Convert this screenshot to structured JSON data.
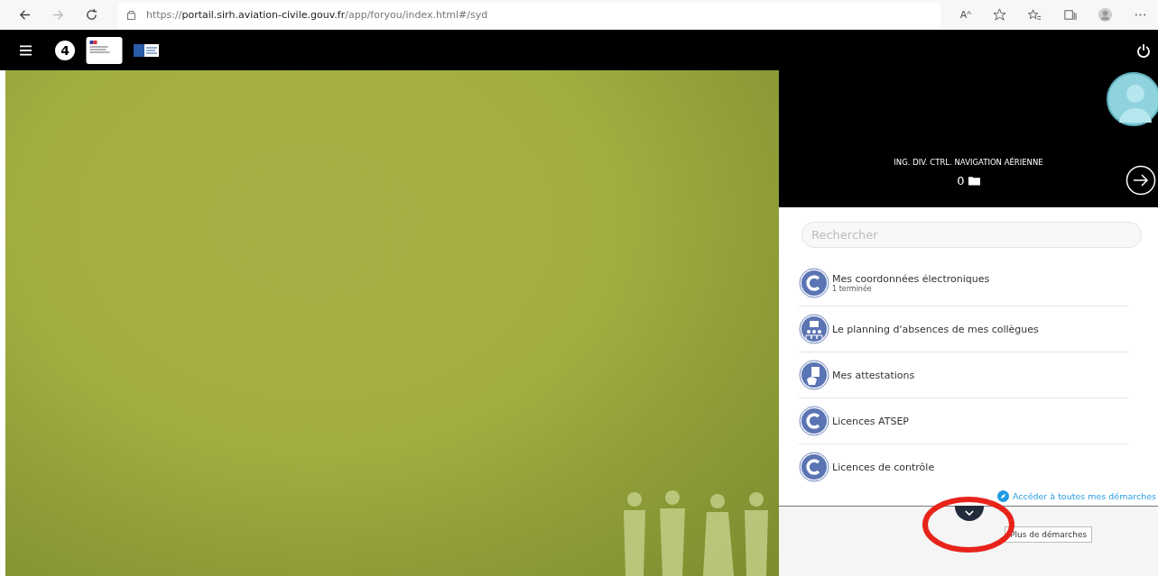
{
  "browser": {
    "url_scheme": "https://",
    "url_host": "portail.sirh.aviation-civile.gouv.fr",
    "url_path": "/app/foryou/index.html#/syd",
    "read_aloud": "Aᴬ"
  },
  "header": {
    "logo_text": "4"
  },
  "profile": {
    "title": "ING. DIV. CTRL. NAVIGATION AÉRIENNE",
    "count": "0"
  },
  "search": {
    "placeholder": "Rechercher"
  },
  "procedures": [
    {
      "kind": "c",
      "title": "Mes coordonnées électroniques",
      "subtitle": "1 terminée"
    },
    {
      "kind": "people",
      "title": "Le planning d'absences de mes collègues"
    },
    {
      "kind": "hand",
      "title": "Mes attestations"
    },
    {
      "kind": "c",
      "title": "Licences ATSEP"
    },
    {
      "kind": "c",
      "title": "Licences de contrôle"
    }
  ],
  "all_link": "Accéder à toutes mes démarches",
  "tooltip": "Plus de démarches"
}
